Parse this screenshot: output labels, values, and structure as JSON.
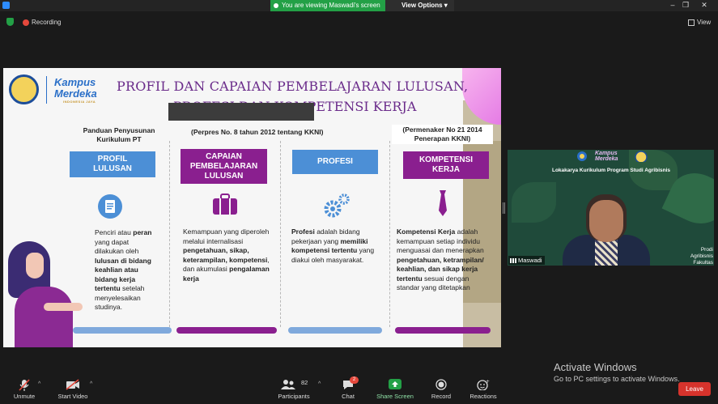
{
  "topbar": {
    "viewing_banner": "You are viewing Maswadi's screen",
    "view_options": "View Options",
    "recording": "Recording",
    "view": "View"
  },
  "slide": {
    "title_line1": "PROFIL DAN CAPAIAN PEMBELAJARAN LULUSAN,",
    "title_line2": "PROFESI DAN KOMPETENSI KERJA",
    "logo_line1": "Kampus",
    "logo_line2": "Merdeka",
    "logo_tag": "INDONESIA JAYA",
    "columns": [
      {
        "head": "Panduan Penyusunan Kurikulum PT",
        "box": "PROFIL LULUSAN",
        "icon": "document-icon",
        "body": [
          "Penciri atau ",
          "peran",
          " yang dapat dilakukan oleh ",
          "lulusan di bidang keahlian atau bidang kerja tertentu",
          " setelah menyelesaikan studinya."
        ]
      },
      {
        "head": "(Perpres No. 8 tahun 2012 tentang KKNI)",
        "box": "CAPAIAN PEMBELAJARAN LULUSAN",
        "icon": "briefcase-icon",
        "body": [
          "Kemampuan yang diperoleh melalui internalisasi ",
          "pengetahuan, sikap, keterampilan, kompetensi",
          ", dan akumulasi ",
          "pengalaman kerja",
          ""
        ]
      },
      {
        "head": "",
        "box": "PROFESI",
        "icon": "gears-icon",
        "body": [
          "",
          "Profesi",
          " adalah bidang pekerjaan yang ",
          "memiliki kompetensi tertentu",
          " yang diakui oleh masyarakat."
        ]
      },
      {
        "head": "(Permenaker No 21 2014 Penerapan KKNI)",
        "box": "KOMPETENSI KERJA",
        "icon": "tie-icon",
        "body": [
          "",
          "Kompetensi Kerja",
          " adalah kemampuan setiap individu menguasai dan menerapkan ",
          "pengetahuan, ketrampilan/ keahlian, dan sikap kerja tertentu",
          " sesuai dengan standar yang ditetapkan"
        ]
      }
    ],
    "colors": {
      "blue": "#4c8fd6",
      "purple": "#8a1f8f",
      "title": "#6a2b8a"
    }
  },
  "video": {
    "title": "Lokakarya Kurikulum Program Studi Agribisnis",
    "name": "Maswadi",
    "logo_line1": "Kampus",
    "logo_line2": "Merdeka",
    "right_text": "Prodi Agribisnis Fakultas Pertanian Universitas Tanjungpura"
  },
  "watermark": {
    "line1": "Activate Windows",
    "line2": "Go to PC settings to activate Windows."
  },
  "toolbar": {
    "unmute": "Unmute",
    "start_video": "Start Video",
    "participants": "Participants",
    "participants_count": "82",
    "chat": "Chat",
    "chat_badge": "2",
    "share_screen": "Share Screen",
    "record": "Record",
    "reactions": "Reactions",
    "leave": "Leave"
  }
}
